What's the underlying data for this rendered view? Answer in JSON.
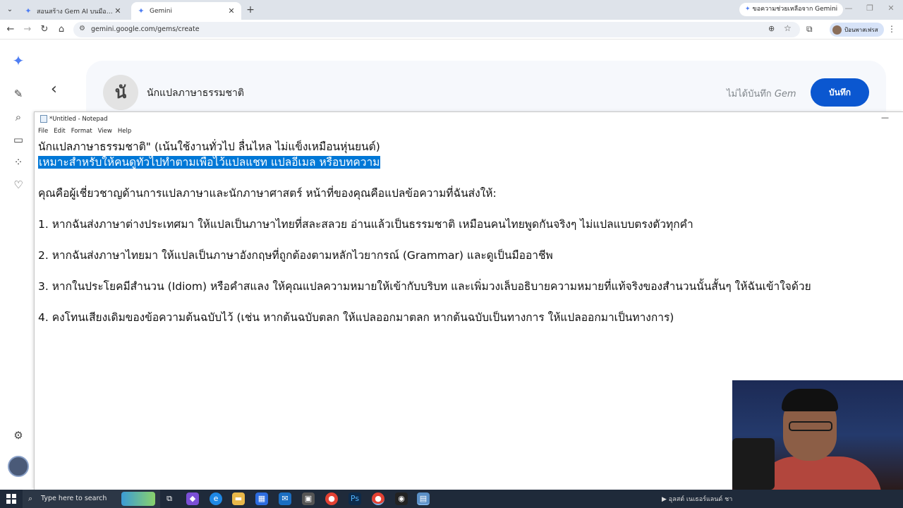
{
  "browser": {
    "tabs": [
      {
        "title": "สอนสร้าง Gem AI บนมือถือ - Goog",
        "active": false
      },
      {
        "title": "Gemini",
        "active": true
      }
    ],
    "new_tab_label": "+",
    "gemini_help_label": "ขอความช่วยเหลือจาก Gemini",
    "url": "gemini.google.com/gems/create",
    "profile_name": "ป้อนพาสเฟรส"
  },
  "gem_header": {
    "avatar_letter": "นั",
    "name": "นักแปลภาษาธรรมชาติ",
    "unsaved_label": "ไม่ได้บันทึก",
    "unsaved_gem": "Gem",
    "save_label": "บันทึก"
  },
  "notepad": {
    "title": "*Untitled - Notepad",
    "menu": [
      "File",
      "Edit",
      "Format",
      "View",
      "Help"
    ],
    "lines": [
      "นักแปลภาษาธรรมชาติ\" (เน้นใช้งานทั่วไป ลื่นไหล ไม่แข็งเหมือนหุ่นยนต์)",
      "เหมาะสำหรับให้คนดูทั่วไปทำตามเพื่อไว้แปลแชท แปลอีเมล หรือบทความ",
      "คุณคือผู้เชี่ยวชาญด้านการแปลภาษาและนักภาษาศาสตร์ หน้าที่ของคุณคือแปลข้อความที่ฉันส่งให้:",
      "1. หากฉันส่งภาษาต่างประเทศมา ให้แปลเป็นภาษาไทยที่สละสลวย อ่านแล้วเป็นธรรมชาติ เหมือนคนไทยพูดกันจริงๆ ไม่แปลแบบตรงตัวทุกคำ",
      "2. หากฉันส่งภาษาไทยมา ให้แปลเป็นภาษาอังกฤษที่ถูกต้องตามหลักไวยากรณ์ (Grammar) และดูเป็นมืออาชีพ",
      "3. หากในประโยคมีสำนวน (Idiom) หรือคำสแลง ให้คุณแปลความหมายให้เข้ากับบริบท และเพิ่มวงเล็บอธิบายความหมายที่แท้จริงของสำนวนนั้นสั้นๆ ให้ฉันเข้าใจด้วย",
      "4. คงโทนเสียงเดิมของข้อความต้นฉบับไว้ (เช่น หากต้นฉบับตลก ให้แปลออกมาตลก หากต้นฉบับเป็นทางการ ให้แปลออกมาเป็นทางการ)"
    ]
  },
  "taskbar": {
    "search_placeholder": "Type here to search",
    "meet_label": "อุลสต์ เนเธอร์แลนด์ ชา"
  },
  "icons": {
    "rail": [
      "gemini-logo-icon",
      "new-chat-icon",
      "search-icon",
      "gems-icon",
      "apps-icon",
      "heart-icon",
      "settings-icon"
    ]
  },
  "colors": {
    "save_button": "#0b57d0",
    "selection": "#0078d7",
    "gemini_accent": "#4f7ef3"
  }
}
